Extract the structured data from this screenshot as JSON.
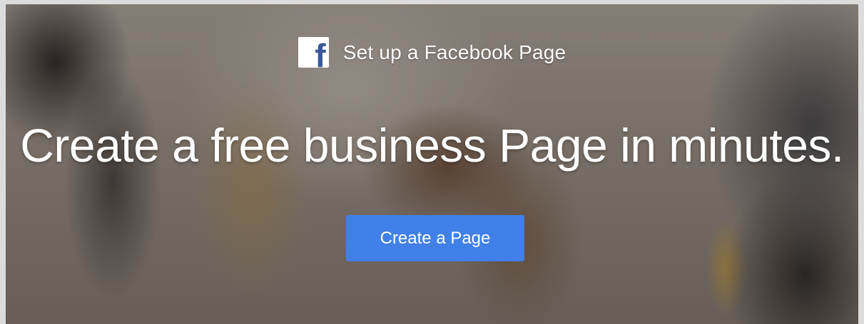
{
  "brand": {
    "logo_glyph": "f",
    "text": "Set up a Facebook Page"
  },
  "hero": {
    "headline": "Create a free business Page in minutes.",
    "cta_label": "Create a Page"
  },
  "colors": {
    "cta": "#4080e8",
    "logo_fg": "#3b5998",
    "logo_bg": "#ffffff",
    "text": "#ffffff"
  }
}
